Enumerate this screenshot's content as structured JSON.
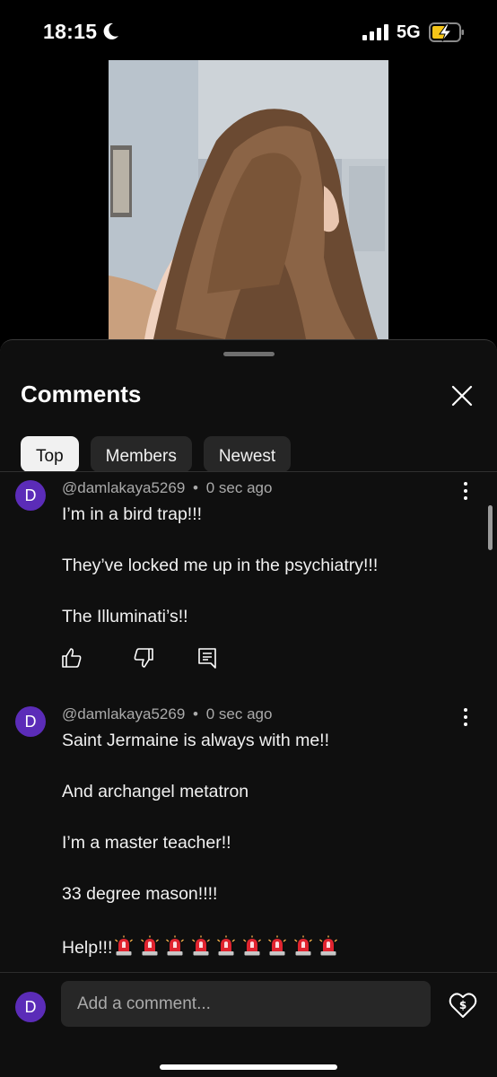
{
  "status_bar": {
    "time": "18:15",
    "network": "5G",
    "icons": [
      "moon-icon",
      "signal-icon",
      "battery-charging-icon"
    ]
  },
  "video": {
    "thumbnail_description_icon": "video-frame"
  },
  "comments_panel": {
    "title": "Comments",
    "close_icon": "close-icon",
    "tabs": [
      {
        "label": "Top",
        "selected": true
      },
      {
        "label": "Members",
        "selected": false
      },
      {
        "label": "Newest",
        "selected": false
      }
    ],
    "comments": [
      {
        "avatar_initial": "D",
        "author": "@damlakaya5269",
        "separator": "•",
        "time": "0 sec ago",
        "lines": [
          "I’m in a bird trap!!!",
          "They’ve locked me up in the psychiatry!!!",
          "The Illuminati’s!!"
        ],
        "actions": [
          "like-icon",
          "dislike-icon",
          "reply-icon"
        ]
      },
      {
        "avatar_initial": "D",
        "author": "@damlakaya5269",
        "separator": "•",
        "time": "0 sec ago",
        "lines": [
          "Saint Jermaine is always with me!!",
          "And archangel metatron",
          "I’m a master teacher!!",
          "33 degree mason!!!!",
          "Help!!!"
        ],
        "trailing_emoji": "police-siren-icon",
        "trailing_emoji_count": 9
      }
    ]
  },
  "composer": {
    "avatar_initial": "D",
    "placeholder": "Add a comment...",
    "thanks_icon": "super-thanks-icon"
  },
  "colors": {
    "background": "#0f0f0f",
    "avatar": "#5b2cb8",
    "chip_active": "#f1f1f1",
    "chip": "#272727",
    "secondary_text": "#aaaaaa"
  }
}
